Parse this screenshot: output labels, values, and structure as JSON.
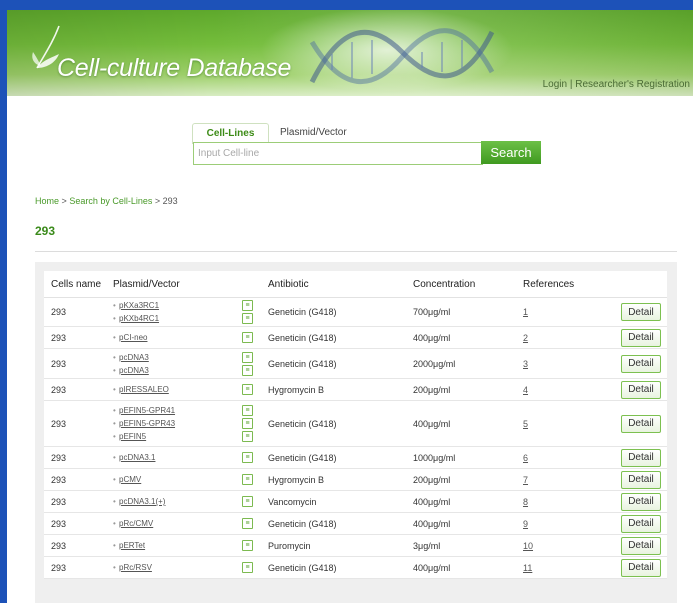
{
  "header": {
    "app_title": "Cell-culture Database",
    "login_link": "Login",
    "separator": "|",
    "register_link": "Researcher's Registration"
  },
  "search": {
    "tab_cell_lines": "Cell-Lines",
    "tab_plasmid_vector": "Plasmid/Vector",
    "placeholder": "Input Cell-line",
    "button_label": "Search"
  },
  "breadcrumb": {
    "home": "Home",
    "sep1": ">",
    "search_by": "Search by Cell-Lines",
    "sep2": ">",
    "current": "293"
  },
  "page_title": "293",
  "table": {
    "columns": [
      "Cells name",
      "Plasmid/Vector",
      "Antibiotic",
      "Concentration",
      "References"
    ],
    "detail_label": "Detail",
    "rows": [
      {
        "cell": "293",
        "plasmids": [
          "pKXa3RC1",
          "pKXb4RC1"
        ],
        "antibiotic": "Geneticin (G418)",
        "concentration": "700μg/ml",
        "ref": "1"
      },
      {
        "cell": "293",
        "plasmids": [
          "pCI-neo"
        ],
        "antibiotic": "Geneticin (G418)",
        "concentration": "400μg/ml",
        "ref": "2"
      },
      {
        "cell": "293",
        "plasmids": [
          "pcDNA3",
          "pcDNA3"
        ],
        "antibiotic": "Geneticin (G418)",
        "concentration": "2000μg/ml",
        "ref": "3"
      },
      {
        "cell": "293",
        "plasmids": [
          "pIRESSALEO"
        ],
        "antibiotic": "Hygromycin B",
        "concentration": "200μg/ml",
        "ref": "4"
      },
      {
        "cell": "293",
        "plasmids": [
          "pEFIN5-GPR41",
          "pEFIN5-GPR43",
          "pEFIN5"
        ],
        "antibiotic": "Geneticin (G418)",
        "concentration": "400μg/ml",
        "ref": "5"
      },
      {
        "cell": "293",
        "plasmids": [
          "pcDNA3.1"
        ],
        "antibiotic": "Geneticin (G418)",
        "concentration": "1000μg/ml",
        "ref": "6"
      },
      {
        "cell": "293",
        "plasmids": [
          "pCMV"
        ],
        "antibiotic": "Hygromycin B",
        "concentration": "200μg/ml",
        "ref": "7"
      },
      {
        "cell": "293",
        "plasmids": [
          "pcDNA3.1(+)"
        ],
        "antibiotic": "Vancomycin",
        "concentration": "400μg/ml",
        "ref": "8"
      },
      {
        "cell": "293",
        "plasmids": [
          "pRc/CMV"
        ],
        "antibiotic": "Geneticin (G418)",
        "concentration": "400μg/ml",
        "ref": "9"
      },
      {
        "cell": "293",
        "plasmids": [
          "pERTet"
        ],
        "antibiotic": "Puromycin",
        "concentration": "3μg/ml",
        "ref": "10"
      },
      {
        "cell": "293",
        "plasmids": [
          "pRc/RSV"
        ],
        "antibiotic": "Geneticin (G418)",
        "concentration": "400μg/ml",
        "ref": "11"
      }
    ]
  },
  "icons": {
    "logo": "leaf-icon",
    "banner_art": "dna-helix-icon",
    "plasmid_doc": "document-icon",
    "bullet": "bullet-icon"
  },
  "colors": {
    "frame_blue": "#1d52b8",
    "brand_green": "#3f9a20",
    "title_green": "#3a8a1a"
  }
}
